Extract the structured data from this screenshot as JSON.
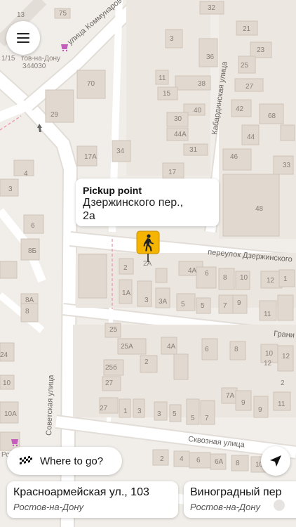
{
  "map": {
    "streets": {
      "kommunarov": "улица Коммунаров",
      "kabardinskaya": "Кабардинская улица",
      "dzerzhinsky": "переулок Дзержинского",
      "granichnaya": "Грани",
      "sovetskaya": "Советская улица",
      "skvoznaya": "Сквозная улица"
    },
    "poi": {
      "city": "тов-на-Дону",
      "postcode": "344030",
      "city2": "Ро",
      "prefix": "1/15"
    },
    "house_numbers": [
      "13",
      "75",
      "32",
      "3",
      "23",
      "21",
      "36",
      "25",
      "11",
      "70",
      "38",
      "27",
      "15",
      "40",
      "42",
      "29",
      "68",
      "30",
      "44A",
      "44",
      "31",
      "46",
      "33",
      "34",
      "17A",
      "17",
      "48",
      "4",
      "3",
      "6",
      "8Б",
      "2",
      "2A",
      "4A",
      "6",
      "8",
      "10",
      "12",
      "1",
      "1A",
      "3",
      "3A",
      "5",
      "5",
      "7",
      "9",
      "11",
      "8A",
      "8",
      "25",
      "25A",
      "4A",
      "2",
      "6",
      "8",
      "10",
      "12",
      "25б",
      "27",
      "7A",
      "9",
      "27",
      "1",
      "3",
      "3",
      "5",
      "5",
      "7",
      "9",
      "11",
      "10",
      "10A",
      "24",
      "2",
      "4",
      "6",
      "6A",
      "8",
      "10",
      "12",
      "2"
    ]
  },
  "menu": {
    "icon": "hamburger-menu-icon"
  },
  "pickup": {
    "title": "Pickup point",
    "address_line1": "Дзержинского пер.,",
    "address_line2": "2а",
    "pin_icon": "pedestrian-icon",
    "pin_color": "#f5b400"
  },
  "where_to": {
    "label": "Where to go?",
    "icon": "checkered-flag-icon"
  },
  "locate": {
    "icon": "navigation-arrow-icon"
  },
  "suggestions": [
    {
      "title": "Красноармейская ул., 103",
      "city": "Ростов-на-Дону"
    },
    {
      "title": "Виноградный пер",
      "city": "Ростов-на-Дону"
    }
  ]
}
